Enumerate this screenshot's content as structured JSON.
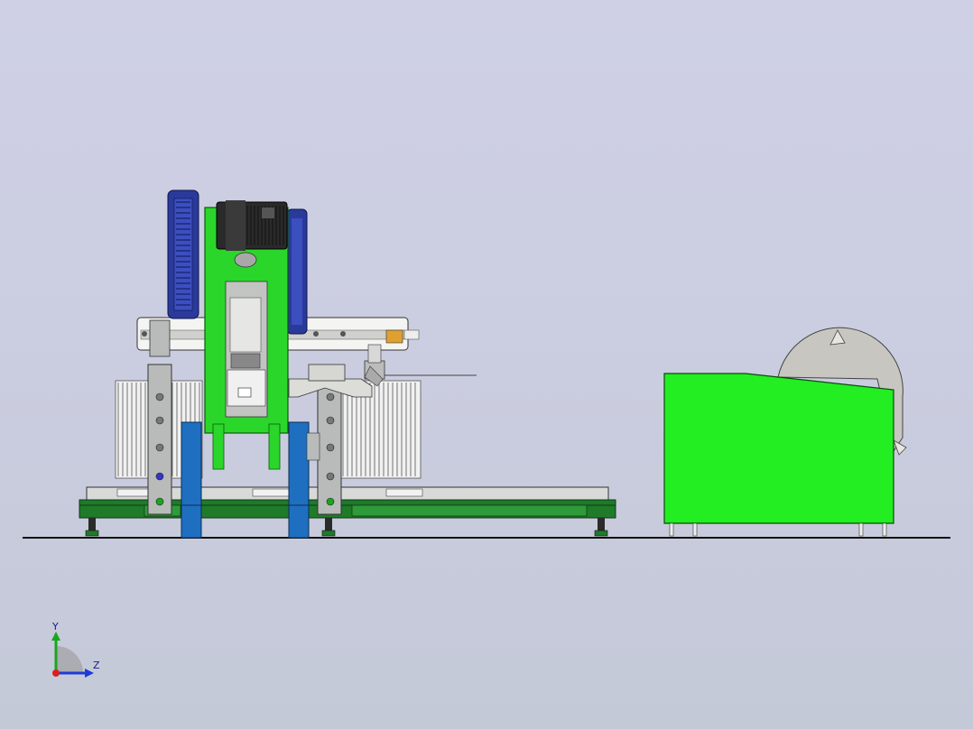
{
  "view": {
    "background_top": "#cfd0e6",
    "background_bottom": "#c4c9d8"
  },
  "colors": {
    "frame_green": "#2bd62b",
    "bin_green": "#22ee22",
    "post_blue": "#1f6fc0",
    "flywheel_blue": "#2a3a9a",
    "steel_gray": "#b9bbbb",
    "base_green": "#1f7a2a",
    "motor_dark": "#2a2a2a",
    "drum_gray": "#c8c6c0"
  },
  "model": {
    "objects": [
      {
        "name": "press-machine"
      },
      {
        "name": "scrap-bin"
      },
      {
        "name": "ground-line"
      }
    ]
  },
  "triad": {
    "y_label": "Y",
    "z_label": "Z"
  }
}
